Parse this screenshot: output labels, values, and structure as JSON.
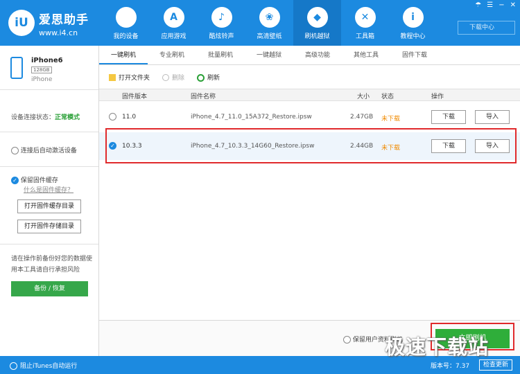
{
  "app": {
    "name": "爱思助手",
    "url": "www.i4.cn",
    "logo_text": "iU"
  },
  "nav": [
    {
      "label": "我的设备",
      "icon": "apple-icon",
      "glyph": ""
    },
    {
      "label": "应用游戏",
      "icon": "appstore-icon",
      "glyph": "A"
    },
    {
      "label": "酷炫铃声",
      "icon": "bell-icon",
      "glyph": "♪"
    },
    {
      "label": "高清壁纸",
      "icon": "flower-icon",
      "glyph": "❀"
    },
    {
      "label": "刷机越狱",
      "icon": "box-icon",
      "glyph": "◆"
    },
    {
      "label": "工具箱",
      "icon": "tools-icon",
      "glyph": "✕"
    },
    {
      "label": "教程中心",
      "icon": "info-icon",
      "glyph": "i"
    }
  ],
  "window_controls": [
    "☂",
    "☰",
    "−",
    "✕"
  ],
  "download_center": "下载中心",
  "device": {
    "name": "iPhone6",
    "capacity": "128GB",
    "model": "iPhone"
  },
  "connection": {
    "label": "设备连接状态：",
    "value": "正常模式"
  },
  "sidebar": {
    "auto_activate": "连接后自动激活设备",
    "keep_cache": "保留固件缓存",
    "what_is_cache": "什么是固件缓存？",
    "open_cache_dir": "打开固件缓存目录",
    "open_storage_dir": "打开固件存储目录",
    "warning": "请在操作前备份好您的数据使用本工具请自行承担风险",
    "backup_button": "备份 / 恢复"
  },
  "tabs": [
    "一键刷机",
    "专业刷机",
    "批量刷机",
    "一键越狱",
    "高级功能",
    "其他工具",
    "固件下载"
  ],
  "toolbar": {
    "open_folder": "打开文件夹",
    "delete": "删除",
    "refresh": "刷新"
  },
  "table": {
    "headers": {
      "version": "固件版本",
      "name": "固件名称",
      "size": "大小",
      "status": "状态",
      "action": "操作"
    },
    "rows": [
      {
        "version": "11.0",
        "name": "iPhone_4.7_11.0_15A372_Restore.ipsw",
        "size": "2.47GB",
        "status": "未下载",
        "download": "下载",
        "import": "导入"
      },
      {
        "version": "10.3.3",
        "name": "iPhone_4.7_10.3.3_14G60_Restore.ipsw",
        "size": "2.44GB",
        "status": "未下载",
        "download": "下载",
        "import": "导入"
      }
    ]
  },
  "bottom": {
    "keep_user_data": "保留用户资料刷机",
    "flash_now": "立即刷机"
  },
  "statusbar": {
    "block_itunes": "阻止iTunes自动运行",
    "version": "版本号：7.37",
    "check_update": "检查更新"
  },
  "watermark": "极速下载站"
}
